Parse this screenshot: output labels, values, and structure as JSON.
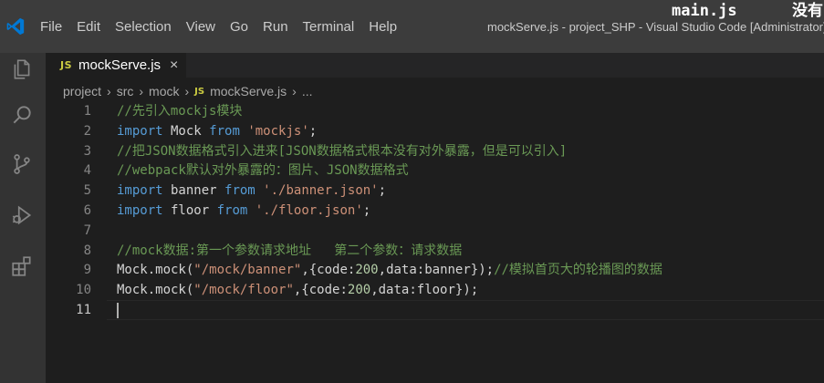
{
  "overlay": {
    "main_js": "main.js",
    "cn_text": "没有"
  },
  "menubar": {
    "items": [
      "File",
      "Edit",
      "Selection",
      "View",
      "Go",
      "Run",
      "Terminal",
      "Help"
    ]
  },
  "window_title": "mockServe.js - project_SHP - Visual Studio Code [Administrator]",
  "tab": {
    "badge": "JS",
    "label": "mockServe.js",
    "close": "×"
  },
  "breadcrumb": {
    "items": [
      "project",
      "src",
      "mock"
    ],
    "file_badge": "JS",
    "file": "mockServe.js",
    "more": "..."
  },
  "editor": {
    "active_line": 11,
    "lines": [
      {
        "n": "1",
        "tokens": [
          [
            "comment",
            "//先引入mockjs模块"
          ]
        ]
      },
      {
        "n": "2",
        "tokens": [
          [
            "kw",
            "import"
          ],
          [
            "id",
            " Mock "
          ],
          [
            "kw",
            "from"
          ],
          [
            "id",
            " "
          ],
          [
            "str",
            "'mockjs'"
          ],
          [
            "punc",
            ";"
          ]
        ]
      },
      {
        "n": "3",
        "tokens": [
          [
            "comment",
            "//把JSON数据格式引入进来[JSON数据格式根本没有对外暴露，但是可以引入]"
          ]
        ]
      },
      {
        "n": "4",
        "tokens": [
          [
            "comment",
            "//webpack默认对外暴露的：图片、JSON数据格式"
          ]
        ]
      },
      {
        "n": "5",
        "tokens": [
          [
            "kw",
            "import"
          ],
          [
            "id",
            " banner "
          ],
          [
            "kw",
            "from"
          ],
          [
            "id",
            " "
          ],
          [
            "str",
            "'./banner.json'"
          ],
          [
            "punc",
            ";"
          ]
        ]
      },
      {
        "n": "6",
        "tokens": [
          [
            "kw",
            "import"
          ],
          [
            "id",
            " floor "
          ],
          [
            "kw",
            "from"
          ],
          [
            "id",
            " "
          ],
          [
            "str",
            "'./floor.json'"
          ],
          [
            "punc",
            ";"
          ]
        ]
      },
      {
        "n": "7",
        "tokens": []
      },
      {
        "n": "8",
        "tokens": [
          [
            "comment",
            "//mock数据:第一个参数请求地址   第二个参数：请求数据"
          ]
        ]
      },
      {
        "n": "9",
        "tokens": [
          [
            "id",
            "Mock.mock("
          ],
          [
            "str",
            "\"/mock/banner\""
          ],
          [
            "punc",
            ",{"
          ],
          [
            "id",
            "code:"
          ],
          [
            "num",
            "200"
          ],
          [
            "punc",
            ","
          ],
          [
            "id",
            "data:banner"
          ],
          [
            "punc",
            "});"
          ],
          [
            "comment",
            "//模拟首页大的轮播图的数据"
          ]
        ]
      },
      {
        "n": "10",
        "tokens": [
          [
            "id",
            "Mock.mock("
          ],
          [
            "str",
            "\"/mock/floor\""
          ],
          [
            "punc",
            ",{"
          ],
          [
            "id",
            "code:"
          ],
          [
            "num",
            "200"
          ],
          [
            "punc",
            ","
          ],
          [
            "id",
            "data:floor"
          ],
          [
            "punc",
            "});"
          ]
        ]
      },
      {
        "n": "11",
        "tokens": []
      }
    ]
  },
  "activity_icons": [
    "explorer-icon",
    "search-icon",
    "source-control-icon",
    "run-debug-icon",
    "extensions-icon"
  ],
  "colors": {
    "keyword": "#569cd6",
    "string": "#ce9178",
    "comment": "#6a9955",
    "number": "#b5cea8",
    "js_badge": "#cbcb41",
    "vscode_blue": "#0078d4"
  }
}
